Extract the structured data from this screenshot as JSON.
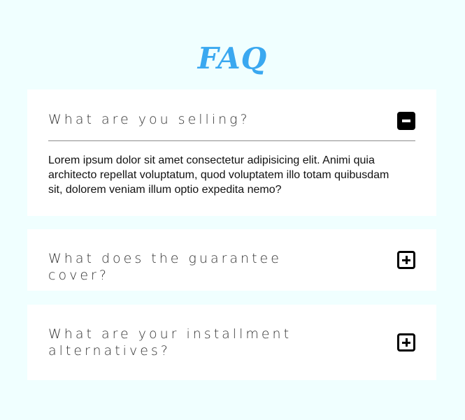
{
  "page": {
    "title": "FAQ",
    "background": "#f0ffff",
    "title_color": "#3aa8f0"
  },
  "faq": [
    {
      "question": "What are you selling?",
      "answer": "Lorem ipsum dolor sit amet consectetur adipisicing elit. Animi quia architecto repellat voluptatum, quod voluptatem illo totam quibusdam sit, dolorem veniam illum optio expedita nemo?",
      "expanded": true,
      "toggle_icon": "minus-icon"
    },
    {
      "question": "What does the guarantee cover?",
      "expanded": false,
      "toggle_icon": "plus-icon"
    },
    {
      "question": "What are your installment alternatives?",
      "expanded": false,
      "toggle_icon": "plus-icon"
    }
  ]
}
